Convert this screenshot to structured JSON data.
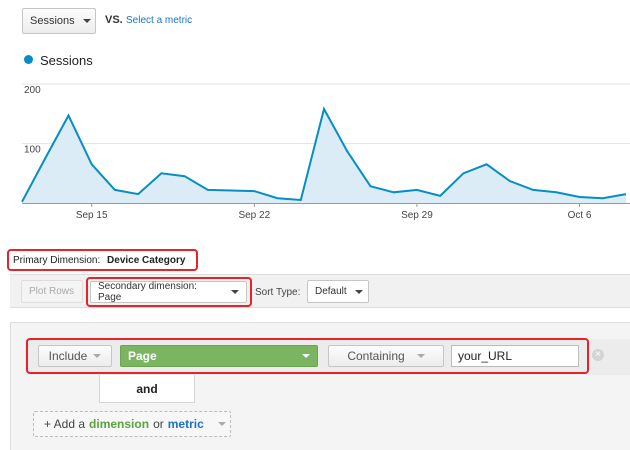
{
  "metric_selector": {
    "primary_metric": "Sessions",
    "vs_label": "VS.",
    "select_metric_link": "Select a metric"
  },
  "legend": {
    "series_name": "Sessions",
    "color": "#058dc7"
  },
  "chart_data": {
    "type": "area",
    "series": [
      {
        "name": "Sessions",
        "values": [
          2,
          75,
          147,
          65,
          22,
          15,
          50,
          45,
          22,
          21,
          20,
          8,
          5,
          158,
          87,
          28,
          18,
          22,
          12,
          50,
          65,
          37,
          22,
          18,
          10,
          8,
          15
        ]
      }
    ],
    "x_tick_labels": [
      "Sep 15",
      "Sep 22",
      "Sep 29",
      "Oct 6"
    ],
    "y_tick_labels": [
      "200",
      "100"
    ],
    "ylim": [
      0,
      200
    ],
    "grid": true,
    "color": "#058dc7",
    "fill": "#dcecf6"
  },
  "primary_dimension": {
    "label": "Primary Dimension:",
    "value": "Device Category"
  },
  "toolbar": {
    "plot_rows": "Plot Rows",
    "secondary_dimension": "Secondary dimension: Page",
    "sort_type_label": "Sort Type:",
    "sort_type_value": "Default"
  },
  "filter": {
    "include": "Include",
    "dimension": "Page",
    "match_type": "Containing",
    "value": "your_URL",
    "and_label": "and",
    "add_prefix": "+ Add a",
    "add_dimension": "dimension",
    "add_or": "or",
    "add_metric": "metric"
  },
  "colors": {
    "highlight": "#e5232b",
    "dimension_green": "#7cb561",
    "link_blue": "#1a73c6"
  }
}
